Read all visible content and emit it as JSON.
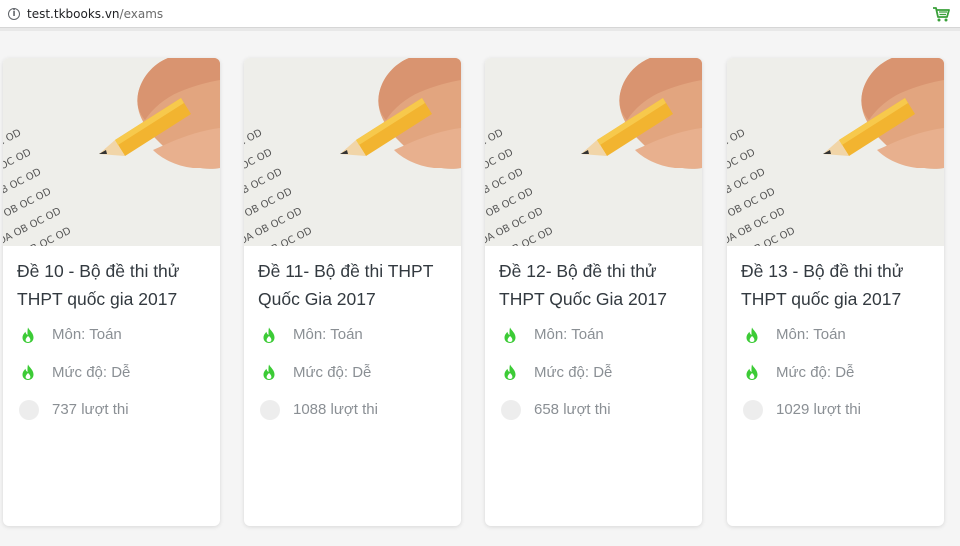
{
  "browser": {
    "url_host": "test.tkbooks.vn",
    "url_path": "/exams"
  },
  "exams": [
    {
      "title_line1": "Đề 10 - Bộ đề thi thử",
      "title_line2": "THPT quốc gia 2017",
      "subject": "Môn: Toán",
      "level": "Mức độ: Dễ",
      "attempts": "737 lượt thi"
    },
    {
      "title_line1": "Đề 11- Bộ đề thi THPT",
      "title_line2": "Quốc Gia 2017",
      "subject": "Môn: Toán",
      "level": "Mức độ: Dễ",
      "attempts": "1088 lượt thi"
    },
    {
      "title_line1": "Đề 12- Bộ đề thi thử",
      "title_line2": "THPT Quốc Gia 2017",
      "subject": "Môn: Toán",
      "level": "Mức độ: Dễ",
      "attempts": "658 lượt thi"
    },
    {
      "title_line1": "Đề 13 - Bộ đề thi thử",
      "title_line2": "THPT quốc gia 2017",
      "subject": "Môn: Toán",
      "level": "Mức độ: Dễ",
      "attempts": "1029 lượt thi"
    }
  ],
  "icons": {
    "subject": "flame-icon",
    "level": "flame-icon",
    "attempts": "attempts-icon"
  },
  "colors": {
    "accent_green": "#3ccb36",
    "title_text": "#333a40",
    "meta_text": "#8a8f94"
  }
}
